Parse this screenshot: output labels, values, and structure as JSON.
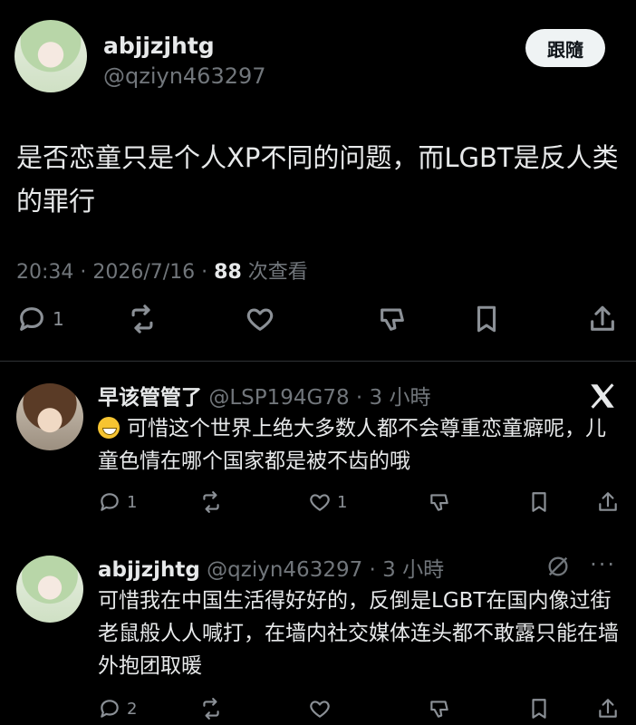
{
  "main_post": {
    "author_name": "abjjzjhtg",
    "author_handle": "@qziyn463297",
    "follow_label": "跟隨",
    "text": "是否恋童只是个人XP不同的问题，而LGBT是反人类的罪行",
    "time": "20:34 · 2026/7/16 · ",
    "views_count": "88",
    "views_label": " 次查看",
    "reply_count": "1"
  },
  "replies": [
    {
      "name": "早该管管了",
      "handle": "@LSP194G78 · 3 小時",
      "text": "可惜这个世界上绝大多数人都不会尊重恋童癖呢，儿童色情在哪个国家都是被不齿的哦",
      "reply_count": "1",
      "like_count": "1"
    },
    {
      "name": "abjjzjhtg",
      "handle": "@qziyn463297 · 3 小時",
      "text": "可惜我在中国生活得好好的，反倒是LGBT在国内像过街老鼠般人人喊打，在墙内社交媒体连头都不敢露只能在墙外抱团取暖",
      "reply_count": "2",
      "more": "···"
    }
  ],
  "icons": {
    "reply": "speech-bubble-icon",
    "repost": "repost-icon",
    "like": "heart-icon",
    "dislike": "thumb-down-icon",
    "bookmark": "bookmark-icon",
    "share": "share-icon",
    "brand": "x-logo-icon",
    "emoji": "grinning-emoji-icon",
    "grok": "grok-icon"
  },
  "colors": {
    "background": "#000000",
    "text": "#e7e9ea",
    "muted": "#71767b",
    "button_bg": "#eff3f4",
    "divider": "#2f3336"
  }
}
